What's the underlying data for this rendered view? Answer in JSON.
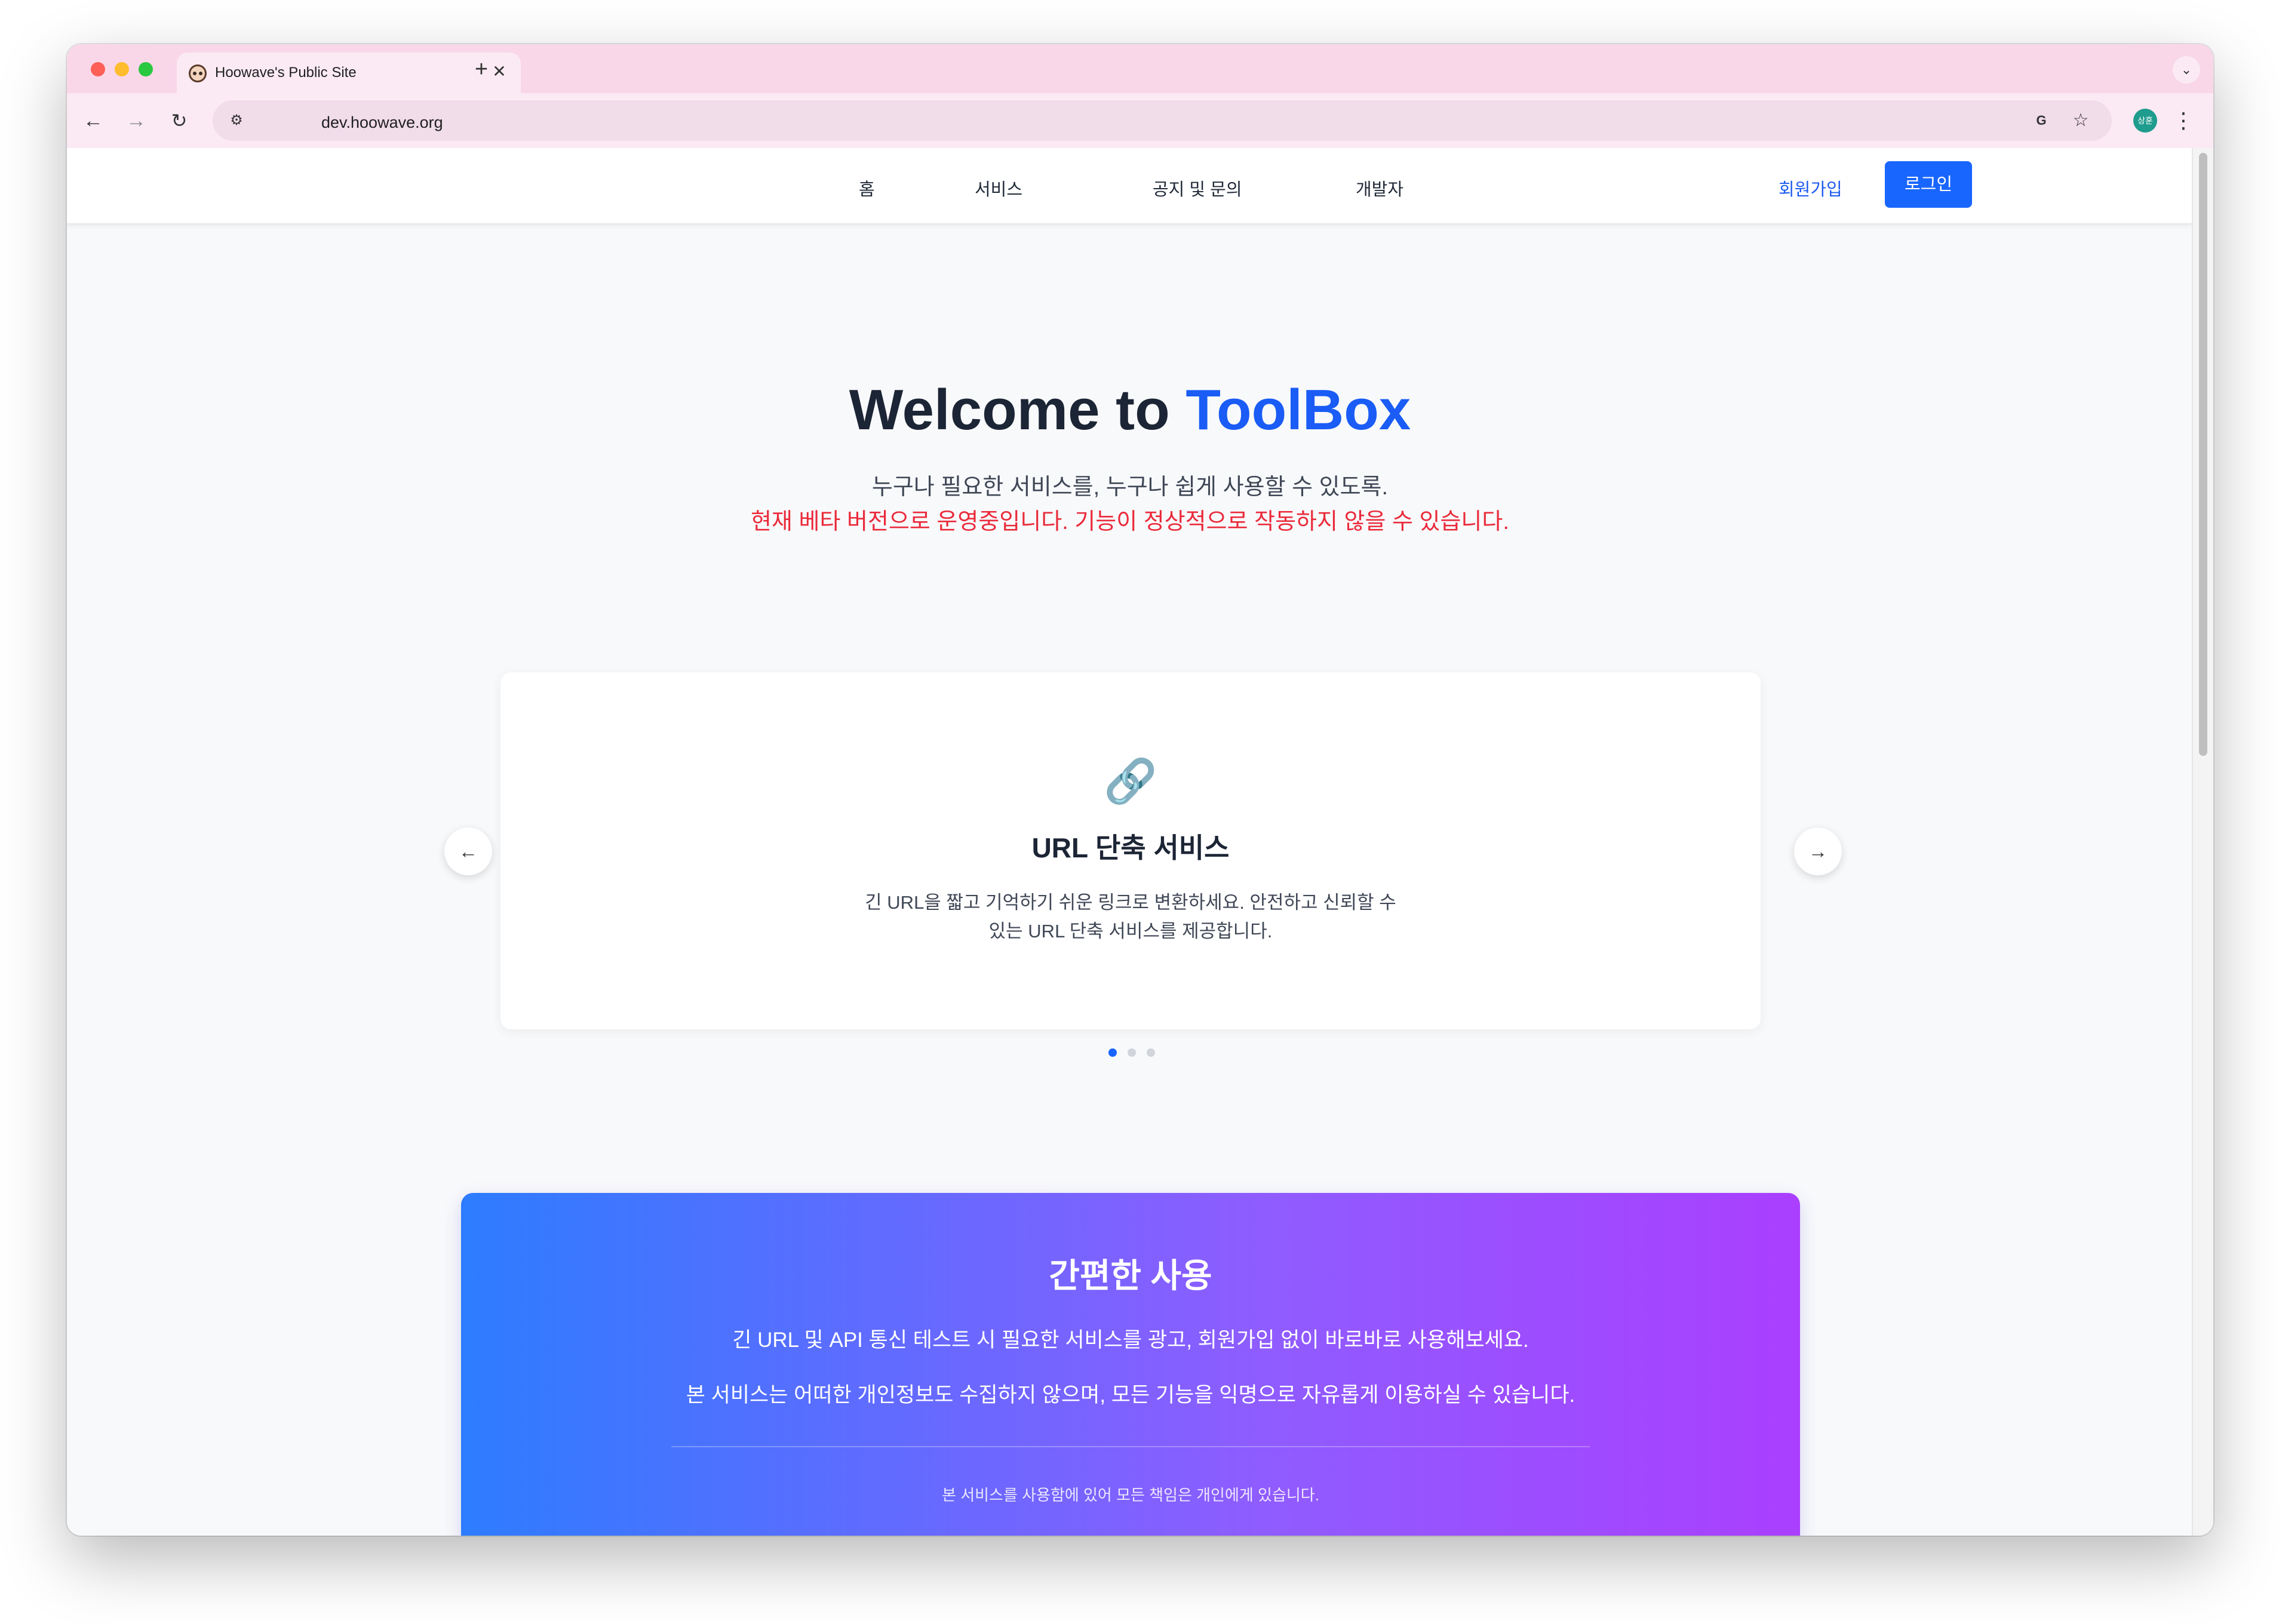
{
  "browser": {
    "tab_title": "Hoowave's Public Site",
    "url": "dev.hoowave.org",
    "profile_initials": "상훈",
    "icons": {
      "close": "close-icon",
      "new_tab": "plus-icon",
      "tab_menu": "chevron-down-icon",
      "back": "arrow-left-icon",
      "forward": "arrow-right-icon",
      "reload": "reload-icon",
      "site_info": "tune-icon",
      "translate": "translate-icon",
      "bookmark": "star-icon",
      "menu": "kebab-icon"
    }
  },
  "nav": {
    "items": [
      "홈",
      "서비스",
      "공지 및 문의",
      "개발자"
    ],
    "signup": "회원가입",
    "login": "로그인"
  },
  "hero": {
    "title_prefix": "Welcome to ",
    "title_accent": "ToolBox",
    "subtitle": "누구나 필요한 서비스를, 누구나 쉽게 사용할 수 있도록.",
    "warning": "현재 베타 버전으로 운영중입니다. 기능이 정상적으로 작동하지 않을 수 있습니다."
  },
  "carousel": {
    "icon": "link-icon",
    "title": "URL 단축 서비스",
    "description": "긴 URL을 짧고 기억하기 쉬운 링크로 변환하세요. 안전하고 신뢰할 수 있는 URL 단축 서비스를 제공합니다.",
    "slide_count": 3,
    "active_index": 0
  },
  "features": {
    "title": "간편한 사용",
    "line1": "긴 URL 및 API 통신 테스트 시 필요한 서비스를 광고, 회원가입 없이 바로바로 사용해보세요.",
    "line2": "본 서비스는 어떠한 개인정보도 수집하지 않으며, 모든 기능을 익명으로 자유롭게 이용하실 수 있습니다.",
    "note": "본 서비스를 사용함에 있어 모든 책임은 개인에게 있습니다."
  },
  "colors": {
    "accent": "#1966ff",
    "warning": "#ea2a3a",
    "tab_strip": "#f9d7e9",
    "gradient_start": "#2d7cff",
    "gradient_end": "#aa3fff"
  }
}
